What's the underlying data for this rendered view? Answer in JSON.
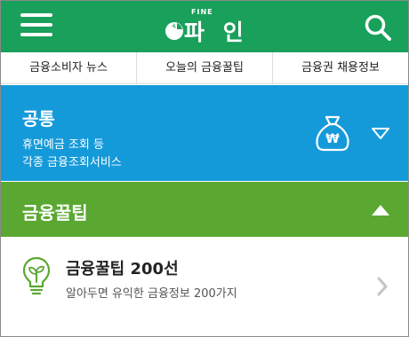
{
  "header": {
    "logo_small": "FINE",
    "logo_text": "파 인",
    "colors": {
      "header": "#19a05a",
      "blue": "#159ad9",
      "green": "#5aa832"
    }
  },
  "tabs": [
    {
      "label": "금융소비자 뉴스"
    },
    {
      "label": "오늘의 금융꿀팁"
    },
    {
      "label": "금융권 채용정보"
    }
  ],
  "sections": {
    "common": {
      "title": "공통",
      "desc_line1": "휴면예금 조회 등",
      "desc_line2": "각종 금융조회서비스",
      "icon": "money-bag-icon",
      "currency": "₩",
      "state": "collapsed"
    },
    "tips": {
      "title": "금융꿀팁",
      "state": "expanded",
      "items": [
        {
          "title": "금융꿀팁 200선",
          "subtitle": "알아두면 유익한 금융정보 200가지",
          "icon": "lightbulb-icon"
        }
      ]
    }
  }
}
